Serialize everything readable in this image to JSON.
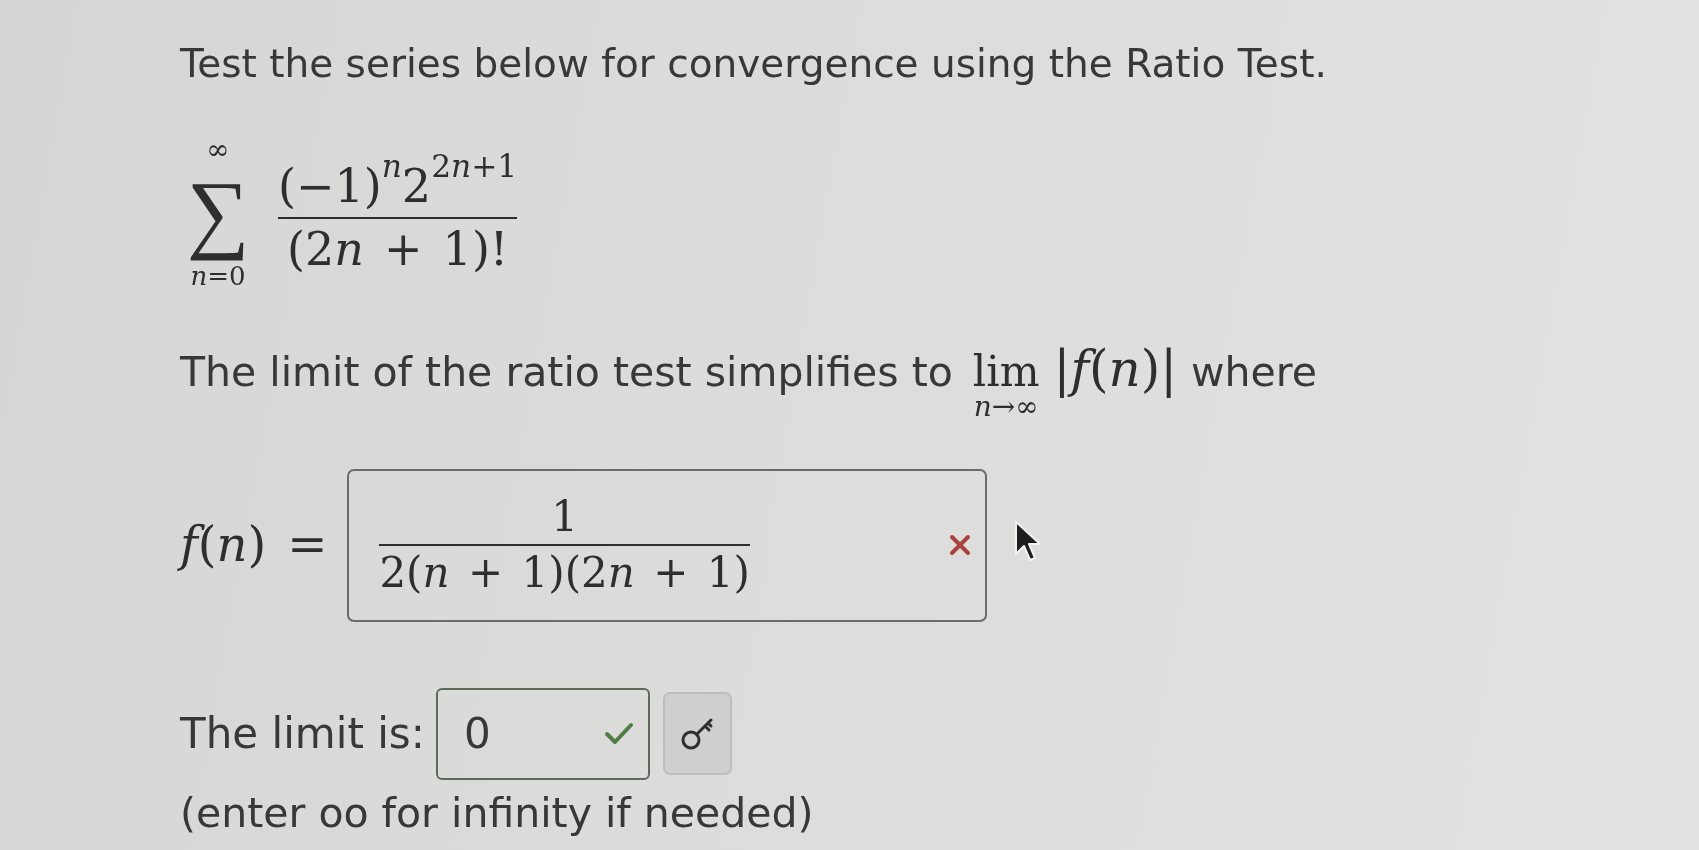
{
  "question": {
    "prompt": "Test the series below for convergence using the Ratio Test."
  },
  "series": {
    "operator": "∑",
    "upper": "∞",
    "lower": "n=0",
    "numerator": "(−1)$^{n}$2$^{2n+1}$",
    "denominator": "(2n + 1)!"
  },
  "limit_statement": {
    "before": "The limit of the ratio test simplifies to",
    "operator": "lim",
    "under": "n→∞",
    "expression": "|f(n)|",
    "after": "where"
  },
  "answers": [
    {
      "kind": "fraction",
      "label": "f(n) =",
      "numerator": "1",
      "denominator": "2(n + 1)(2n + 1)",
      "correct": false
    },
    {
      "kind": "value",
      "label": "The limit is:",
      "value": "0",
      "correct": true,
      "key_button": true
    }
  ],
  "hint": "(enter oo for infinity if needed)"
}
